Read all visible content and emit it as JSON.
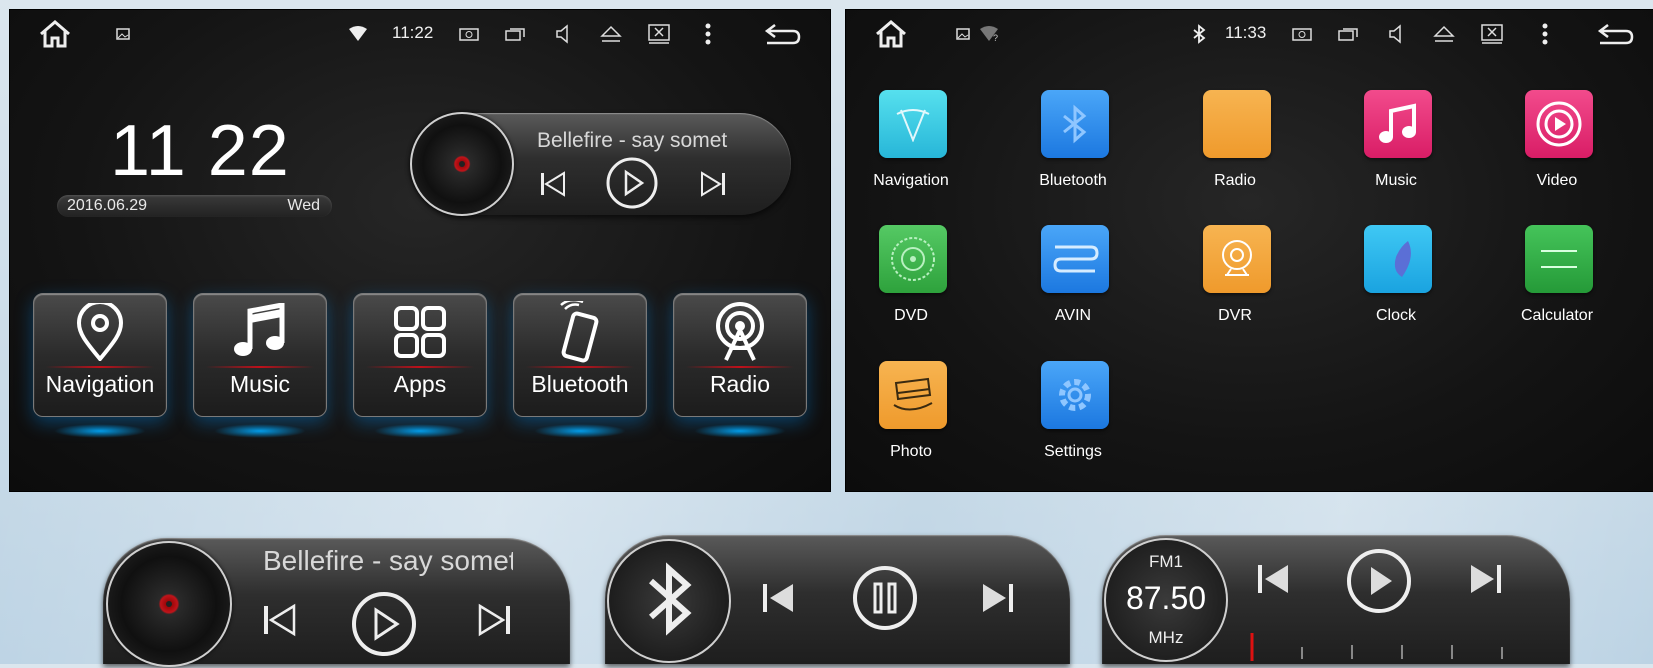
{
  "left_screen": {
    "status": {
      "time": "11:22"
    },
    "clock": {
      "time": "11 22",
      "date": "2016.06.29",
      "weekday": "Wed"
    },
    "player": {
      "song": "Bellefire - say somet"
    },
    "tiles": [
      {
        "label": "Navigation",
        "icon": "location-pin-icon"
      },
      {
        "label": "Music",
        "icon": "music-note-icon"
      },
      {
        "label": "Apps",
        "icon": "apps-grid-icon"
      },
      {
        "label": "Bluetooth",
        "icon": "phone-bluetooth-icon"
      },
      {
        "label": "Radio",
        "icon": "radio-tower-icon"
      }
    ]
  },
  "right_screen": {
    "status": {
      "time": "11:33"
    },
    "apps": [
      {
        "label": "Navigation",
        "color": "#3fd2e6"
      },
      {
        "label": "Bluetooth",
        "color": "#2e8ff0"
      },
      {
        "label": "Radio",
        "color": "#f3a53a"
      },
      {
        "label": "Music",
        "color": "#e8317a"
      },
      {
        "label": "Video",
        "color": "#e8317a"
      },
      {
        "label": "DVD",
        "color": "#3db64a"
      },
      {
        "label": "AVIN",
        "color": "#2e8ff0"
      },
      {
        "label": "DVR",
        "color": "#f3a53a"
      },
      {
        "label": "Clock",
        "color": "#2bb6ec"
      },
      {
        "label": "Calculator",
        "color": "#2fb44a"
      },
      {
        "label": "Photo",
        "color": "#f3a53a"
      },
      {
        "label": "Settings",
        "color": "#2e8ff0"
      }
    ]
  },
  "widgets": {
    "music": {
      "song": "Bellefire - say somet"
    },
    "radio": {
      "band": "FM1",
      "frequency": "87.50",
      "unit": "MHz"
    }
  }
}
